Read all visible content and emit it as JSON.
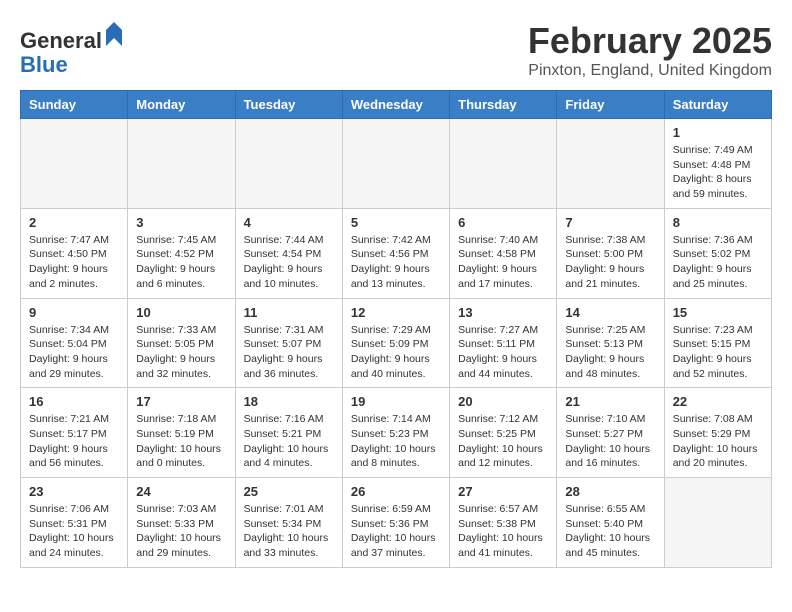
{
  "header": {
    "logo_line1": "General",
    "logo_line2": "Blue",
    "month_year": "February 2025",
    "location": "Pinxton, England, United Kingdom"
  },
  "weekdays": [
    "Sunday",
    "Monday",
    "Tuesday",
    "Wednesday",
    "Thursday",
    "Friday",
    "Saturday"
  ],
  "weeks": [
    [
      {
        "day": "",
        "info": ""
      },
      {
        "day": "",
        "info": ""
      },
      {
        "day": "",
        "info": ""
      },
      {
        "day": "",
        "info": ""
      },
      {
        "day": "",
        "info": ""
      },
      {
        "day": "",
        "info": ""
      },
      {
        "day": "1",
        "info": "Sunrise: 7:49 AM\nSunset: 4:48 PM\nDaylight: 8 hours and 59 minutes."
      }
    ],
    [
      {
        "day": "2",
        "info": "Sunrise: 7:47 AM\nSunset: 4:50 PM\nDaylight: 9 hours and 2 minutes."
      },
      {
        "day": "3",
        "info": "Sunrise: 7:45 AM\nSunset: 4:52 PM\nDaylight: 9 hours and 6 minutes."
      },
      {
        "day": "4",
        "info": "Sunrise: 7:44 AM\nSunset: 4:54 PM\nDaylight: 9 hours and 10 minutes."
      },
      {
        "day": "5",
        "info": "Sunrise: 7:42 AM\nSunset: 4:56 PM\nDaylight: 9 hours and 13 minutes."
      },
      {
        "day": "6",
        "info": "Sunrise: 7:40 AM\nSunset: 4:58 PM\nDaylight: 9 hours and 17 minutes."
      },
      {
        "day": "7",
        "info": "Sunrise: 7:38 AM\nSunset: 5:00 PM\nDaylight: 9 hours and 21 minutes."
      },
      {
        "day": "8",
        "info": "Sunrise: 7:36 AM\nSunset: 5:02 PM\nDaylight: 9 hours and 25 minutes."
      }
    ],
    [
      {
        "day": "9",
        "info": "Sunrise: 7:34 AM\nSunset: 5:04 PM\nDaylight: 9 hours and 29 minutes."
      },
      {
        "day": "10",
        "info": "Sunrise: 7:33 AM\nSunset: 5:05 PM\nDaylight: 9 hours and 32 minutes."
      },
      {
        "day": "11",
        "info": "Sunrise: 7:31 AM\nSunset: 5:07 PM\nDaylight: 9 hours and 36 minutes."
      },
      {
        "day": "12",
        "info": "Sunrise: 7:29 AM\nSunset: 5:09 PM\nDaylight: 9 hours and 40 minutes."
      },
      {
        "day": "13",
        "info": "Sunrise: 7:27 AM\nSunset: 5:11 PM\nDaylight: 9 hours and 44 minutes."
      },
      {
        "day": "14",
        "info": "Sunrise: 7:25 AM\nSunset: 5:13 PM\nDaylight: 9 hours and 48 minutes."
      },
      {
        "day": "15",
        "info": "Sunrise: 7:23 AM\nSunset: 5:15 PM\nDaylight: 9 hours and 52 minutes."
      }
    ],
    [
      {
        "day": "16",
        "info": "Sunrise: 7:21 AM\nSunset: 5:17 PM\nDaylight: 9 hours and 56 minutes."
      },
      {
        "day": "17",
        "info": "Sunrise: 7:18 AM\nSunset: 5:19 PM\nDaylight: 10 hours and 0 minutes."
      },
      {
        "day": "18",
        "info": "Sunrise: 7:16 AM\nSunset: 5:21 PM\nDaylight: 10 hours and 4 minutes."
      },
      {
        "day": "19",
        "info": "Sunrise: 7:14 AM\nSunset: 5:23 PM\nDaylight: 10 hours and 8 minutes."
      },
      {
        "day": "20",
        "info": "Sunrise: 7:12 AM\nSunset: 5:25 PM\nDaylight: 10 hours and 12 minutes."
      },
      {
        "day": "21",
        "info": "Sunrise: 7:10 AM\nSunset: 5:27 PM\nDaylight: 10 hours and 16 minutes."
      },
      {
        "day": "22",
        "info": "Sunrise: 7:08 AM\nSunset: 5:29 PM\nDaylight: 10 hours and 20 minutes."
      }
    ],
    [
      {
        "day": "23",
        "info": "Sunrise: 7:06 AM\nSunset: 5:31 PM\nDaylight: 10 hours and 24 minutes."
      },
      {
        "day": "24",
        "info": "Sunrise: 7:03 AM\nSunset: 5:33 PM\nDaylight: 10 hours and 29 minutes."
      },
      {
        "day": "25",
        "info": "Sunrise: 7:01 AM\nSunset: 5:34 PM\nDaylight: 10 hours and 33 minutes."
      },
      {
        "day": "26",
        "info": "Sunrise: 6:59 AM\nSunset: 5:36 PM\nDaylight: 10 hours and 37 minutes."
      },
      {
        "day": "27",
        "info": "Sunrise: 6:57 AM\nSunset: 5:38 PM\nDaylight: 10 hours and 41 minutes."
      },
      {
        "day": "28",
        "info": "Sunrise: 6:55 AM\nSunset: 5:40 PM\nDaylight: 10 hours and 45 minutes."
      },
      {
        "day": "",
        "info": ""
      }
    ]
  ]
}
